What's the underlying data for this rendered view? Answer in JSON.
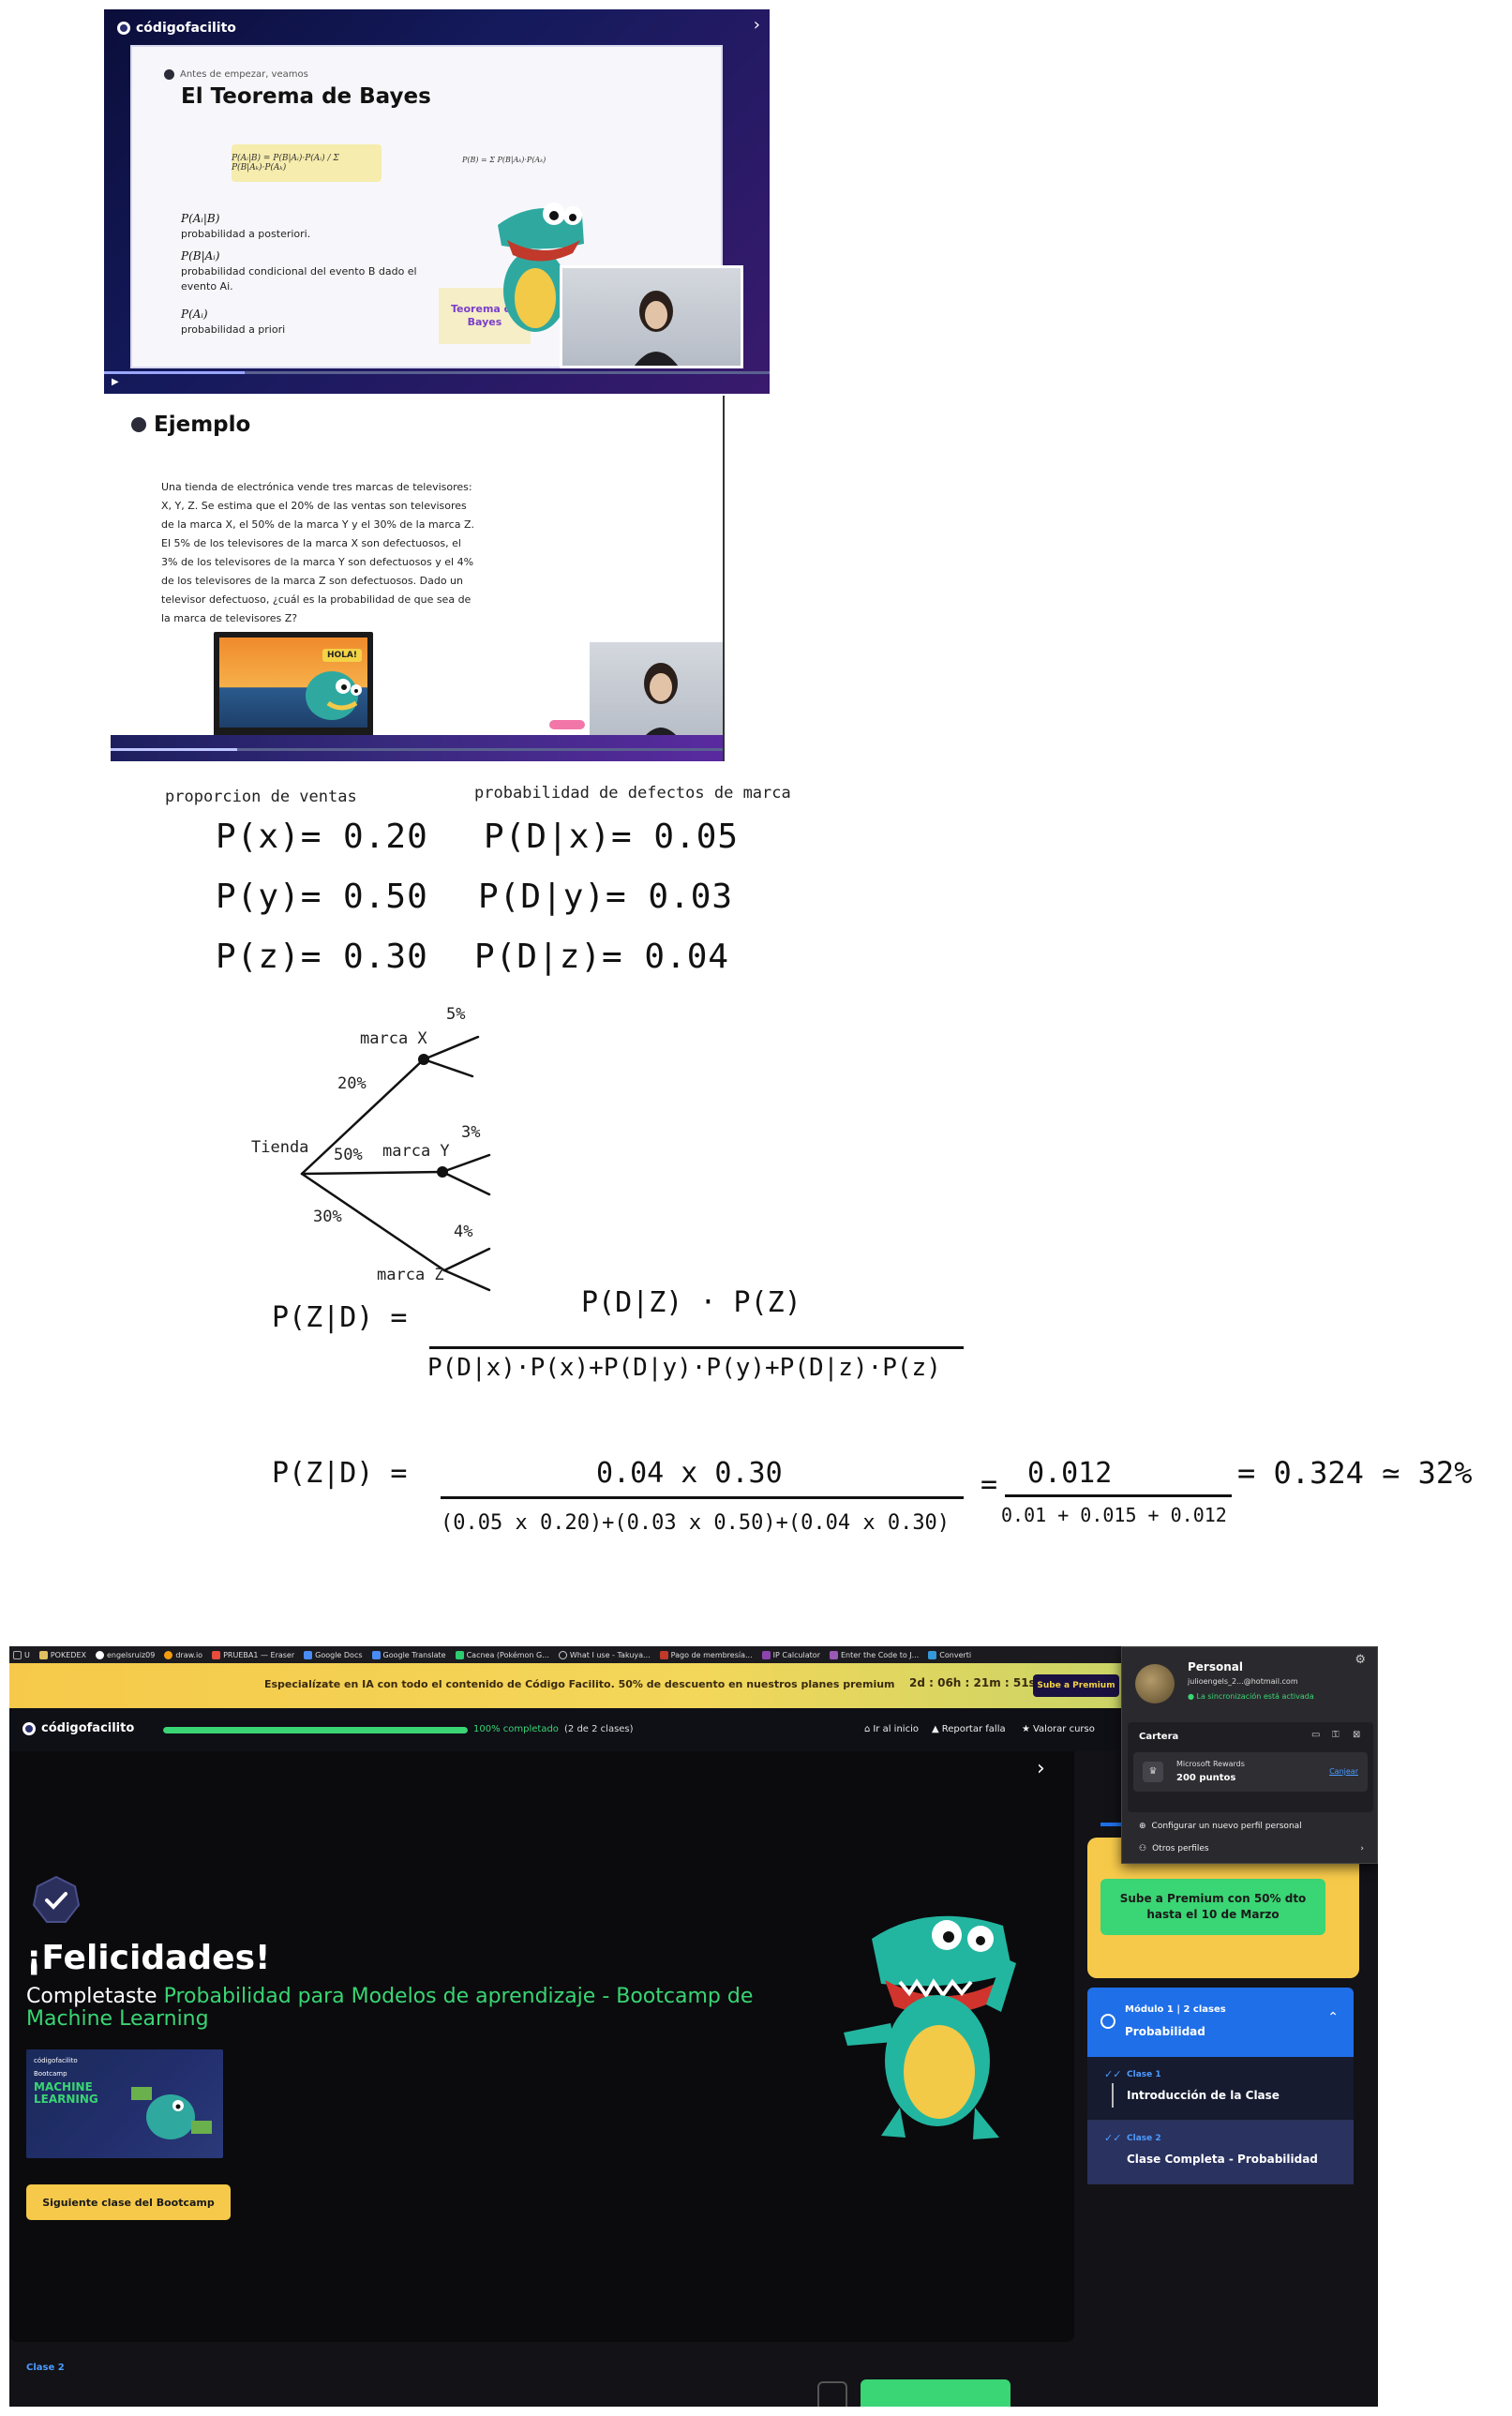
{
  "slide1": {
    "brand": "códigofacilito",
    "pre": "Antes de empezar, veamos",
    "title": "El Teorema de Bayes",
    "formula": "P(Aᵢ|B) = P(B|Aᵢ)·P(Aᵢ) / Σ P(B|Aₖ)·P(Aₖ)",
    "formula2": "P(B) = Σ P(B|Aₖ)·P(Aₖ)",
    "terms": [
      {
        "term": "P(Aᵢ|B)",
        "desc": "probabilidad a posteriori."
      },
      {
        "term": "P(B|Aᵢ)",
        "desc": "probabilidad condicional del evento B dado el evento Ai."
      },
      {
        "term": "P(Aᵢ)",
        "desc": "probabilidad a priori"
      }
    ],
    "tag": "Teorema de Bayes"
  },
  "slide2": {
    "title": "Ejemplo",
    "paragraph": "Una tienda de electrónica vende tres marcas de televisores: X, Y, Z. Se estima que el 20% de las ventas son televisores de la marca X, el 50% de la marca Y y el 30% de la marca Z. El 5% de los televisores de la marca X son defectuosos, el 3% de los televisores de la marca Y son defectuosos y el 4% de los televisores de la marca Z son defectuosos. Dado un televisor defectuoso, ¿cuál es la probabilidad de que sea de la marca de televisores Z?",
    "hola": "HOLA!"
  },
  "notes": {
    "left_header": "proporcion de ventas",
    "right_header": "probabilidad de defectos de marca",
    "left": [
      "P(x)= 0.20",
      "P(y)= 0.50",
      "P(z)= 0.30"
    ],
    "right": [
      "P(D|x)= 0.05",
      "P(D|y)= 0.03",
      "P(D|z)= 0.04"
    ],
    "tree": {
      "root": "Tienda",
      "branches": [
        {
          "label": "marca X",
          "pct": "20%",
          "leaf": "5%"
        },
        {
          "label": "marca Y",
          "pct": "50%",
          "leaf": "3%"
        },
        {
          "label": "marca Z",
          "pct": "30%",
          "leaf": "4%"
        }
      ]
    },
    "eq1_lhs": "P(Z|D) =",
    "eq1_num": "P(D|Z) · P(Z)",
    "eq1_den": "P(D|x)·P(x)+P(D|y)·P(y)+P(D|z)·P(z)",
    "eq2_lhs": "P(Z|D) =",
    "eq2_num": "0.04 x 0.30",
    "eq2_den": "(0.05 x 0.20)+(0.03 x 0.50)+(0.04 x 0.30)",
    "eq2_num2": "0.012",
    "eq2_den2": "0.01 + 0.015 + 0.012",
    "eq2_res": "= 0.324 ≃ 32%"
  },
  "browser": {
    "bookmarks": [
      "U",
      "POKEDEX",
      "engelsruiz09",
      "draw.io",
      "PRUEBA1 — Eraser",
      "Google Docs",
      "Google Translate",
      "Cacnea (Pokémon G...",
      "What I use - Takuya...",
      "Pago de membresía...",
      "IP Calculator",
      "Enter the Code to J...",
      "Converti"
    ],
    "promo_text": "Especialízate en IA con todo el contenido de Código Facilito. 50% de descuento en nuestros planes premium",
    "countdown": "2d : 06h : 21m : 51s",
    "promo_btn": "Sube a Premium",
    "brand": "códigofacilito",
    "progress_pct": 100,
    "progress_label": "100% completado",
    "progress_classes": "(2 de 2 clases)",
    "nav": [
      "Ir al inicio",
      "Reportar falla",
      "Valorar curso"
    ],
    "congrats": "¡Felicidades!",
    "completed_prefix": "Completaste",
    "completed_course": "Probabilidad para Modelos de aprendizaje - Bootcamp de Machine Learning",
    "thumb_brand": "códigofacilito",
    "thumb_sub": "Bootcamp",
    "thumb_title": "MACHINE LEARNING",
    "next_btn": "Siguiente clase del Bootcamp",
    "bottom_label": "Clase 2",
    "premium_btn": "Sube a Premium con 50% dto hasta el 10 de Marzo",
    "module_line1": "Módulo 1  |  2 clases",
    "module_title": "Probabilidad",
    "classes": [
      {
        "k": "Clase 1",
        "v": "Introducción de la Clase"
      },
      {
        "k": "Clase 2",
        "v": "Clase Completa - Probabilidad"
      }
    ],
    "profile": {
      "name": "Personal",
      "email": "julioengels_2...@hotmail.com",
      "sync": "La sincronización está activada",
      "wallet": "Cartera",
      "rewards_label": "Microsoft Rewards",
      "rewards_points": "200 puntos",
      "rewards_link": "Canjear",
      "opt1": "Configurar un nuevo perfil personal",
      "opt2": "Otros perfiles"
    }
  },
  "colors": {
    "accent_green": "#3ad574",
    "accent_yellow": "#f6c94a",
    "accent_blue": "#1f6fe8"
  }
}
